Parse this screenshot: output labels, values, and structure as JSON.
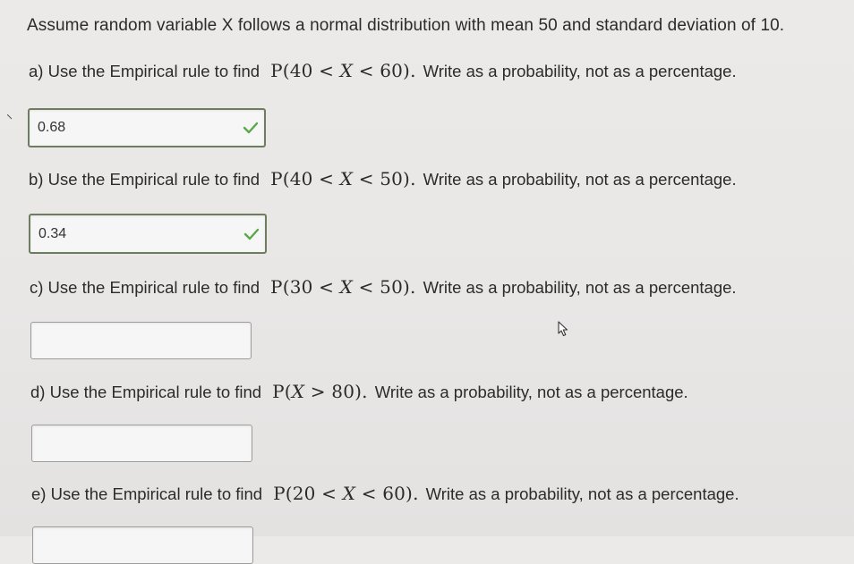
{
  "intro": "Assume random variable X follows a normal distribution with mean 50 and standard deviation of 10.",
  "questions": [
    {
      "label": "a) Use the Empirical rule to find",
      "math_p": "P(40 < ",
      "math_var": "X",
      "math_rest": " < 60).",
      "suffix": "Write as a probability, not as a percentage.",
      "answer_value": "0.68",
      "status": "correct"
    },
    {
      "label": "b) Use the Empirical rule to find",
      "math_p": "P(40 < ",
      "math_var": "X",
      "math_rest": " < 50).",
      "suffix": "Write as a probability, not as a percentage.",
      "answer_value": "0.34",
      "status": "correct"
    },
    {
      "label": "c) Use the Empirical rule to find",
      "math_p": "P(30 < ",
      "math_var": "X",
      "math_rest": " < 50).",
      "suffix": "Write as a probability, not as a percentage.",
      "answer_value": "",
      "status": "empty"
    },
    {
      "label": "d) Use the Empirical rule to find",
      "math_p": "P(",
      "math_var": "X",
      "math_rest": " > 80).",
      "suffix": "Write as a probability, not as a percentage.",
      "answer_value": "",
      "status": "empty"
    },
    {
      "label": "e) Use the Empirical rule to find",
      "math_p": "P(20 < ",
      "math_var": "X",
      "math_rest": " < 60).",
      "suffix": "Write as a probability, not as a percentage.",
      "answer_value": "",
      "status": "empty"
    }
  ],
  "icons": {
    "check": "check-icon",
    "cursor": "mouse-pointer-icon"
  },
  "colors": {
    "check_green": "#5aa84a",
    "correct_border": "#6e7c60"
  }
}
